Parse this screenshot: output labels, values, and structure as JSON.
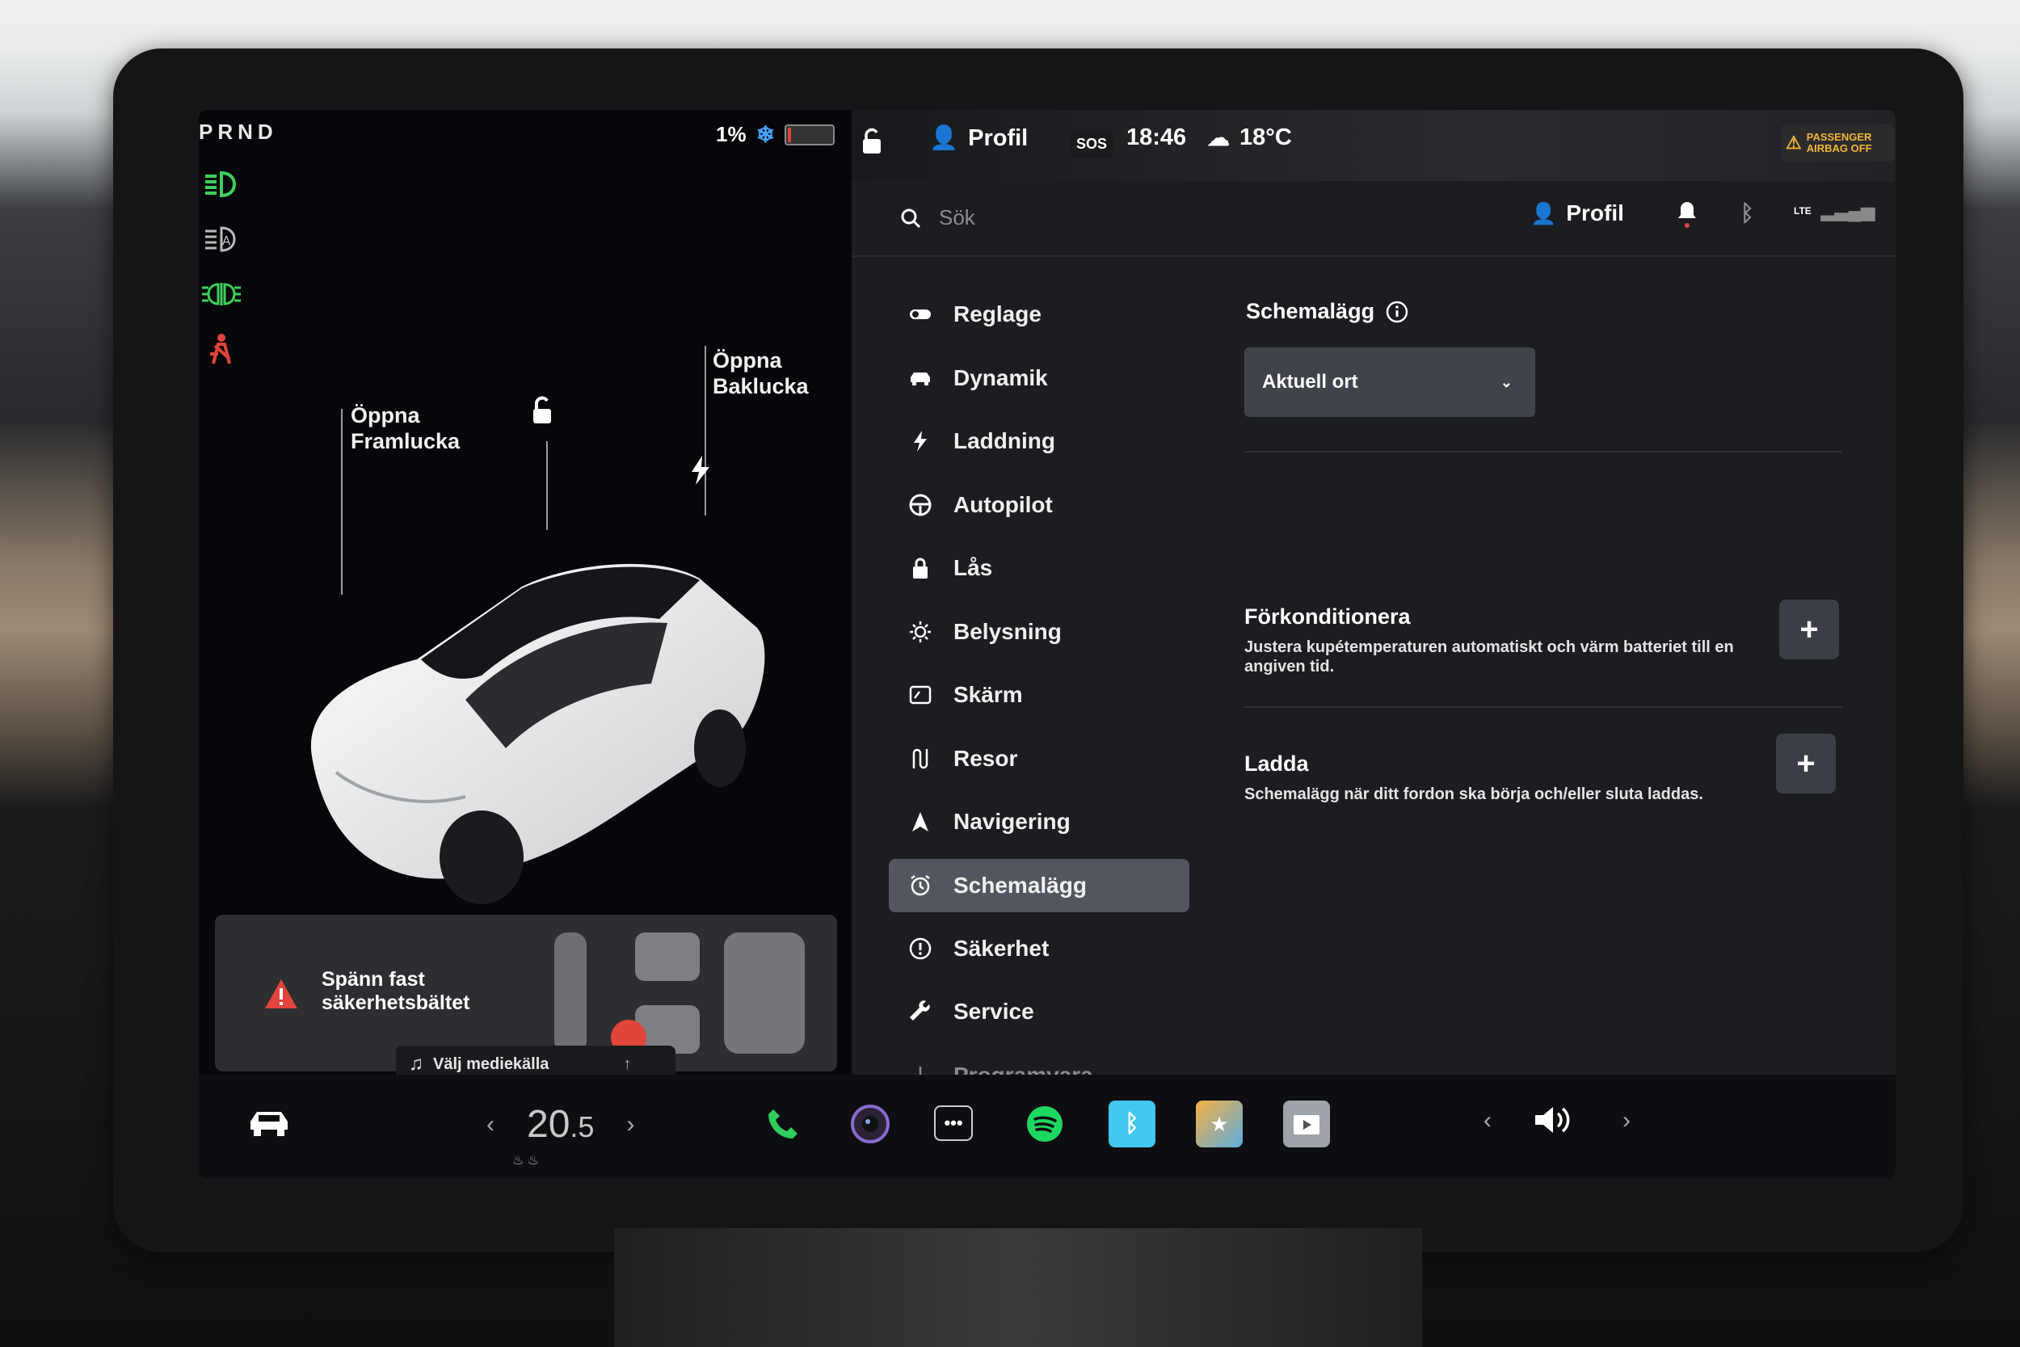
{
  "left": {
    "prnd": "PRND",
    "battery_percent": "1%",
    "label_front": [
      "Öppna",
      "Framlucka"
    ],
    "label_rear": [
      "Öppna",
      "Baklucka"
    ],
    "alert_text": [
      "Spänn fast",
      "säkerhetsbältet"
    ],
    "media_label": "Välj mediekälla"
  },
  "topbar": {
    "profile": "Profil",
    "sos": "SOS",
    "time": "18:46",
    "temperature": "18°C",
    "airbag": [
      "PASSENGER",
      "AIRBAG OFF"
    ]
  },
  "search": {
    "placeholder": "Sök",
    "profile": "Profil",
    "network": "LTE"
  },
  "menu": {
    "items": [
      {
        "label": "Reglage",
        "icon": "toggle-icon"
      },
      {
        "label": "Dynamik",
        "icon": "car-icon"
      },
      {
        "label": "Laddning",
        "icon": "bolt-icon"
      },
      {
        "label": "Autopilot",
        "icon": "steering-wheel-icon"
      },
      {
        "label": "Lås",
        "icon": "lock-icon"
      },
      {
        "label": "Belysning",
        "icon": "sun-icon"
      },
      {
        "label": "Skärm",
        "icon": "display-icon"
      },
      {
        "label": "Resor",
        "icon": "trips-icon"
      },
      {
        "label": "Navigering",
        "icon": "navigation-icon"
      },
      {
        "label": "Schemalägg",
        "icon": "alarm-clock-icon",
        "selected": true
      },
      {
        "label": "Säkerhet",
        "icon": "exclamation-circle-icon"
      },
      {
        "label": "Service",
        "icon": "wrench-icon"
      },
      {
        "label": "Programvara",
        "icon": "download-icon"
      }
    ]
  },
  "schedule": {
    "title": "Schemalägg",
    "location": "Aktuell ort",
    "precondition_title": "Förkonditionera",
    "precondition_desc": "Justera kupétemperaturen automatiskt och värm batteriet till en angiven tid.",
    "charge_title": "Ladda",
    "charge_desc": "Schemalägg när ditt fordon ska börja och/eller sluta laddas.",
    "add": "+"
  },
  "dock": {
    "temp_whole": "20",
    "temp_decimal": ".5",
    "prev": "‹",
    "next": "›"
  },
  "colors": {
    "selected_bg": "#52565e",
    "headlight_green": "#3ecf5c",
    "seatbelt_red": "#e0443a",
    "bluetooth_app": "#42c8f0",
    "spotify": "#1ed760"
  }
}
